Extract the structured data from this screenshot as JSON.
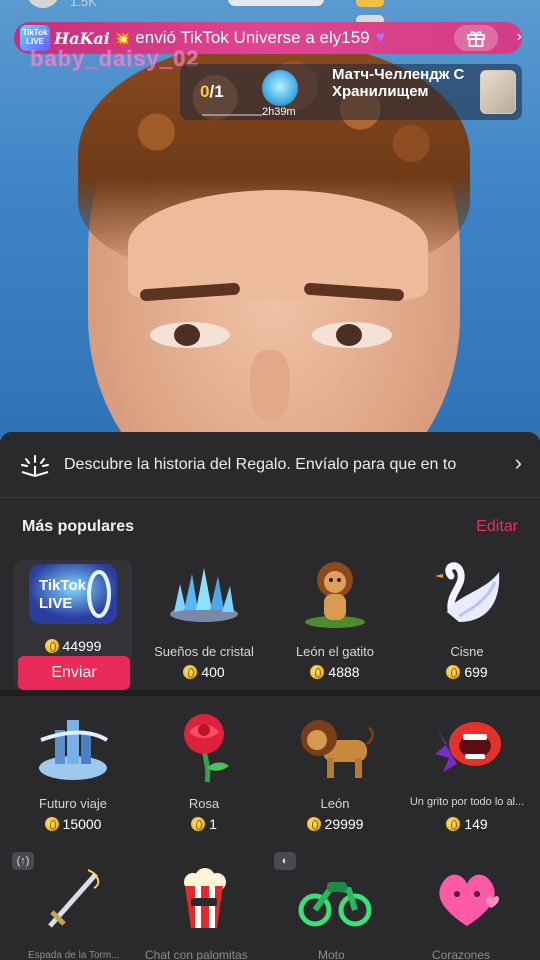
{
  "top": {
    "viewers": "1.5K"
  },
  "banner": {
    "badge": "TikTok LIVE",
    "sender": "HaKai",
    "message": "envió TikTok Universe a ely159",
    "heart_icon": "purple-heart-icon",
    "gift_icon": "gift-icon"
  },
  "ghost_username": "baby_daisy_02",
  "match": {
    "current": "0",
    "total": "/1",
    "timer": "2h39m",
    "title": "Матч-Челлендж С Хранилищем"
  },
  "sheet": {
    "story_text": "Descubre la historia del Regalo. Envíalo para que en to",
    "section_title": "Más populares",
    "edit_label": "Editar",
    "send_label": "Enviar",
    "gifts": [
      {
        "name": "TikTok LIVE",
        "price": "44999",
        "icon": "tiktok-universe-icon",
        "selected": true
      },
      {
        "name": "Sueños de cristal",
        "price": "400",
        "icon": "crystal-crown-icon"
      },
      {
        "name": "León el gatito",
        "price": "4888",
        "icon": "lion-cub-icon"
      },
      {
        "name": "Cisne",
        "price": "699",
        "icon": "swan-icon"
      },
      {
        "name": "Futuro viaje",
        "price": "15000",
        "icon": "future-city-icon"
      },
      {
        "name": "Rosa",
        "price": "1",
        "icon": "rose-icon"
      },
      {
        "name": "León",
        "price": "29999",
        "icon": "lion-icon"
      },
      {
        "name": "Un grito por todo lo al...",
        "price": "149",
        "icon": "shouting-mouth-icon"
      }
    ],
    "bottom_row": [
      {
        "name": "Espada de la Torm...",
        "icon": "sword-icon"
      },
      {
        "name": "Chat con palomitas",
        "icon": "popcorn-icon"
      },
      {
        "name": "Moto",
        "icon": "motorcycle-icon"
      },
      {
        "name": "Corazones",
        "icon": "hearts-icon"
      }
    ]
  },
  "colors": {
    "accent": "#ea2a58",
    "edit": "#e5315c",
    "banner": "#d23c86",
    "sheet_bg": "#2a2a2d"
  }
}
